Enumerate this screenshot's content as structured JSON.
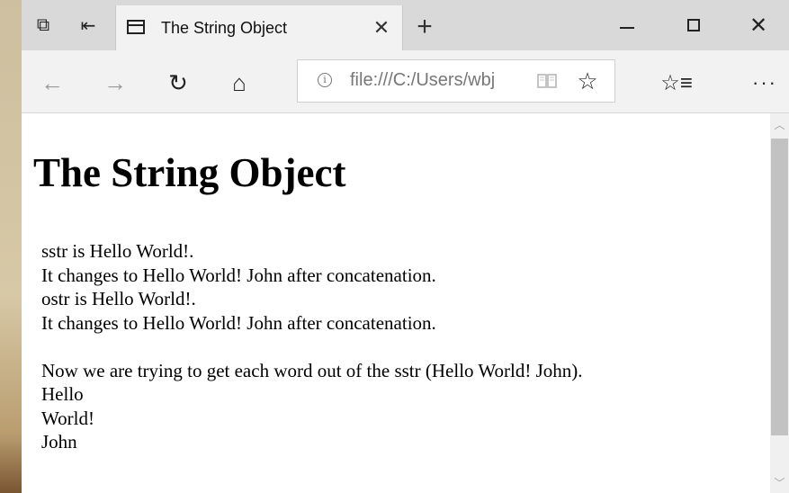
{
  "tab": {
    "title": "The String Object",
    "close": "✕"
  },
  "new_tab": "+",
  "address": {
    "info": "i",
    "url": "file:///C:/Users/wbj"
  },
  "icons": {
    "tab_previews": "⧉",
    "set_aside": "⇤",
    "back": "←",
    "forward": "→",
    "refresh": "↻",
    "home": "⌂",
    "reading_view": "📖",
    "favorite_star": "☆",
    "favorites_list": "☆≡",
    "more": "···",
    "close_window": "✕",
    "scroll_up": "︿",
    "scroll_down": "﹀"
  },
  "page": {
    "heading": "The String Object",
    "lines": [
      "sstr is Hello World!.",
      "It changes to Hello World! John after concatenation.",
      "ostr is Hello World!.",
      "It changes to Hello World! John after concatenation.",
      "",
      "Now we are trying to get each word out of the sstr (Hello World! John).",
      "Hello",
      "World!",
      "John"
    ]
  }
}
